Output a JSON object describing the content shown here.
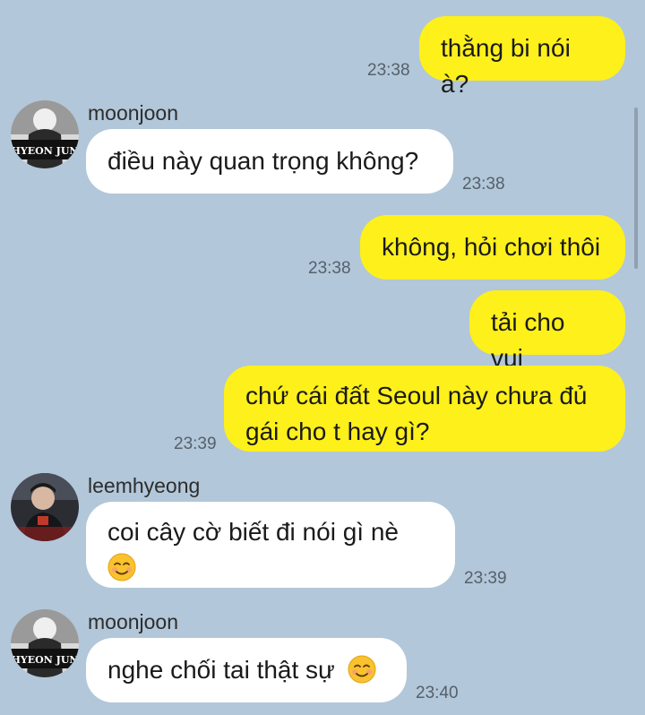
{
  "messages": [
    {
      "direction": "out",
      "text": "thằng bi nói à?",
      "time": "23:38"
    },
    {
      "direction": "in",
      "sender": "moonjoon",
      "avatar_icon": "hyeon-jun-avatar",
      "avatar_text": "HYEON JUN",
      "text": "điều này quan trọng không?",
      "time": "23:38"
    },
    {
      "direction": "out",
      "text": "không, hỏi chơi thôi",
      "time": "23:38"
    },
    {
      "direction": "out",
      "text": "tải cho vui"
    },
    {
      "direction": "out",
      "text_line1": "chứ cái đất Seoul này chưa đủ",
      "text_line2": "gái cho t hay gì?",
      "time": "23:39"
    },
    {
      "direction": "in",
      "sender": "leemhyeong",
      "avatar_icon": "leemhyeong-avatar",
      "text_line1": "coi cây cờ biết đi nói gì nè",
      "emoji": "smiling-face-emoji",
      "time": "23:39"
    },
    {
      "direction": "in",
      "sender": "moonjoon",
      "avatar_icon": "hyeon-jun-avatar",
      "avatar_text": "HYEON JUN",
      "text": "nghe chối tai thật sự",
      "emoji": "smiling-face-emoji",
      "time": "23:40"
    }
  ],
  "colors": {
    "background": "#b2c7d9",
    "outgoing_bubble": "#fef01b",
    "incoming_bubble": "#ffffff"
  }
}
